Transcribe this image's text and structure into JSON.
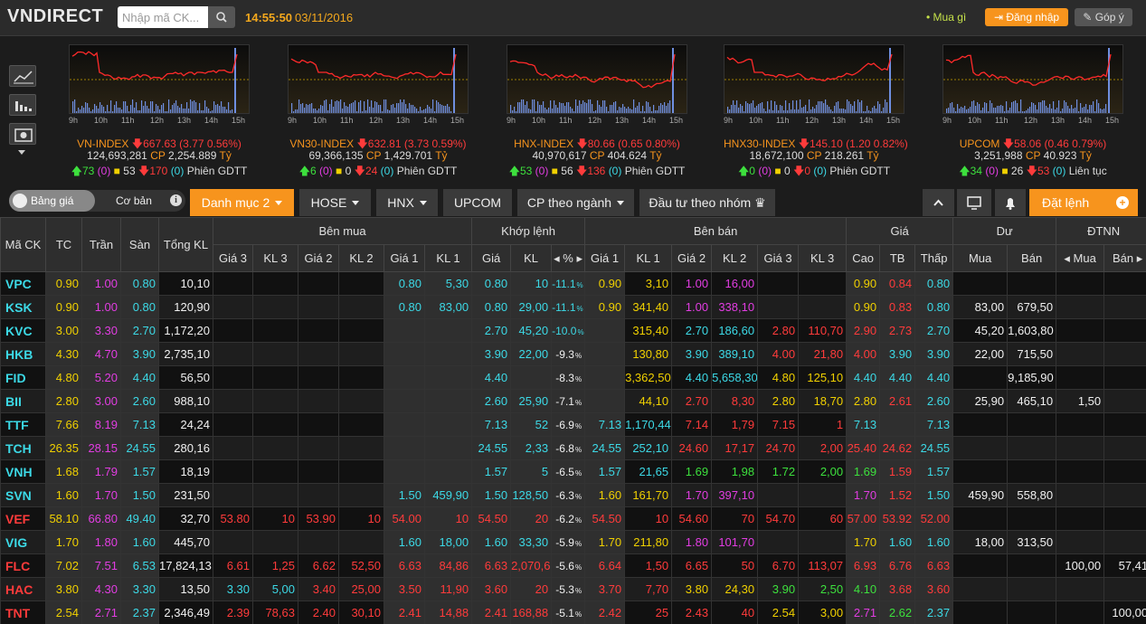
{
  "header": {
    "logo": "VNDIRECT",
    "search_placeholder": "Nhập mã CK...",
    "time": "14:55:50",
    "date": "03/11/2016",
    "mua_gi": "Mua gì",
    "login_label": "Đăng nhập",
    "feedback_label": "Góp ý"
  },
  "colors": {
    "accent": "#f7941d",
    "up": "#3de03d",
    "down": "#ff3b3b",
    "ref": "#f0d000",
    "ceiling": "#e23de2",
    "floor": "#3cd9e6"
  },
  "index_ticks": [
    "9h",
    "10h",
    "11h",
    "12h",
    "13h",
    "14h",
    "15h"
  ],
  "indices": [
    {
      "name": "VN-INDEX",
      "value": "667.63",
      "change": "(3.77 0.56%)",
      "volume": "124,693,281",
      "cp_label": "CP",
      "cp_value": "2,254.889",
      "unit": "Tỷ",
      "up": "73",
      "up_ceiling": "(0)",
      "ref": "53",
      "down": "170",
      "down_floor": "(0)",
      "session": "Phiên GDTT"
    },
    {
      "name": "VN30-INDEX",
      "value": "632.81",
      "change": "(3.73 0.59%)",
      "volume": "69,366,135",
      "cp_label": "CP",
      "cp_value": "1,429.701",
      "unit": "Tỷ",
      "up": "6",
      "up_ceiling": "(0)",
      "ref": "0",
      "down": "24",
      "down_floor": "(0)",
      "session": "Phiên GDTT"
    },
    {
      "name": "HNX-INDEX",
      "value": "80.66",
      "change": "(0.65 0.80%)",
      "volume": "40,970,617",
      "cp_label": "CP",
      "cp_value": "404.624",
      "unit": "Tỷ",
      "up": "53",
      "up_ceiling": "(0)",
      "ref": "56",
      "down": "136",
      "down_floor": "(0)",
      "session": "Phiên GDTT"
    },
    {
      "name": "HNX30-INDEX",
      "value": "145.10",
      "change": "(1.20 0.82%)",
      "volume": "18,672,100",
      "cp_label": "CP",
      "cp_value": "218.261",
      "unit": "Tỷ",
      "up": "0",
      "up_ceiling": "(0)",
      "ref": "0",
      "down": "0",
      "down_floor": "(0)",
      "session": "Phiên GDTT"
    },
    {
      "name": "UPCOM",
      "value": "58.06",
      "change": "(0.46 0.79%)",
      "volume": "3,251,988",
      "cp_label": "CP",
      "cp_value": "40.923",
      "unit": "Tỷ",
      "up": "34",
      "up_ceiling": "(0)",
      "ref": "26",
      "down": "53",
      "down_floor": "(0)",
      "session": "Liên tục"
    }
  ],
  "tabs": {
    "toggle_on": "Bảng giá",
    "toggle_off": "Cơ bản",
    "items": [
      "Danh mục 2",
      "HOSE",
      "HNX",
      "UPCOM",
      "CP theo ngành",
      "Đầu tư theo nhóm"
    ],
    "order_button": "Đặt lệnh"
  },
  "table": {
    "group_headers": {
      "symbol": "Mã CK",
      "tc": "TC",
      "tran": "Trần",
      "san": "Sàn",
      "total": "Tổng KL",
      "buy": "Bên mua",
      "match": "Khớp lệnh",
      "sell": "Bên bán",
      "price": "Giá",
      "remain": "Dư",
      "foreign": "ĐTNN"
    },
    "sub_headers": [
      "Giá 3",
      "KL 3",
      "Giá 2",
      "KL 2",
      "Giá 1",
      "KL 1",
      "Giá",
      "KL",
      "%",
      "Giá 1",
      "KL 1",
      "Giá 2",
      "KL 2",
      "Giá 3",
      "KL 3",
      "Cao",
      "TB",
      "Thấp",
      "Mua",
      "Bán",
      "Mua",
      "Bán"
    ],
    "rows": [
      {
        "c": [
          "VPC",
          "0.90",
          "1.00",
          "0.80",
          "10,10",
          "",
          "",
          "",
          "",
          "0.80",
          "5,30",
          "0.80",
          "10",
          "-11.1",
          "0.90",
          "3,10",
          "1.00",
          "16,00",
          "",
          "",
          "0.90",
          "0.84",
          "0.80",
          "",
          "",
          "",
          ""
        ],
        "k": [
          "cyan",
          "yellow",
          "purple",
          "cyan",
          "white",
          "",
          "",
          "",
          "",
          "cyan",
          "cyan",
          "cyan",
          "cyan",
          "cyan",
          "yellow",
          "yellow",
          "purple",
          "purple",
          "",
          "",
          "yellow",
          "red",
          "cyan",
          "",
          "",
          "",
          ""
        ]
      },
      {
        "c": [
          "KSK",
          "0.90",
          "1.00",
          "0.80",
          "120,90",
          "",
          "",
          "",
          "",
          "0.80",
          "83,00",
          "0.80",
          "29,00",
          "-11.1",
          "0.90",
          "341,40",
          "1.00",
          "338,10",
          "",
          "",
          "0.90",
          "0.83",
          "0.80",
          "83,00",
          "679,50",
          "",
          ""
        ],
        "k": [
          "cyan",
          "yellow",
          "purple",
          "cyan",
          "white",
          "",
          "",
          "",
          "",
          "cyan",
          "cyan",
          "cyan",
          "cyan",
          "cyan",
          "yellow",
          "yellow",
          "purple",
          "purple",
          "",
          "",
          "yellow",
          "red",
          "cyan",
          "white",
          "white",
          "",
          ""
        ]
      },
      {
        "c": [
          "KVC",
          "3.00",
          "3.30",
          "2.70",
          "1,172,20",
          "",
          "",
          "",
          "",
          "",
          "",
          "2.70",
          "45,20",
          "-10.0",
          "",
          "315,40",
          "2.70",
          "186,60",
          "2.80",
          "110,70",
          "2.90",
          "2.73",
          "2.70",
          "45,20",
          "1,603,80",
          "",
          ""
        ],
        "k": [
          "cyan",
          "yellow",
          "purple",
          "cyan",
          "white",
          "",
          "",
          "",
          "",
          "",
          "",
          "cyan",
          "cyan",
          "cyan",
          "",
          "yellow",
          "cyan",
          "cyan",
          "red",
          "red",
          "red",
          "red",
          "cyan",
          "white",
          "white",
          "",
          ""
        ]
      },
      {
        "c": [
          "HKB",
          "4.30",
          "4.70",
          "3.90",
          "2,735,10",
          "",
          "",
          "",
          "",
          "",
          "",
          "3.90",
          "22,00",
          "-9.3",
          "",
          "130,80",
          "3.90",
          "389,10",
          "4.00",
          "21,80",
          "4.00",
          "3.90",
          "3.90",
          "22,00",
          "715,50",
          "",
          ""
        ],
        "k": [
          "cyan",
          "yellow",
          "purple",
          "cyan",
          "white",
          "",
          "",
          "",
          "",
          "",
          "",
          "cyan",
          "cyan",
          "white",
          "",
          "yellow",
          "cyan",
          "cyan",
          "red",
          "red",
          "red",
          "cyan",
          "cyan",
          "white",
          "white",
          "",
          ""
        ]
      },
      {
        "c": [
          "FID",
          "4.80",
          "5.20",
          "4.40",
          "56,50",
          "",
          "",
          "",
          "",
          "",
          "",
          "4.40",
          "",
          "-8.3",
          "",
          "3,362,50",
          "4.40",
          "5,658,30",
          "4.80",
          "125,10",
          "4.40",
          "4.40",
          "4.40",
          "",
          "9,185,90",
          "",
          ""
        ],
        "k": [
          "cyan",
          "yellow",
          "purple",
          "cyan",
          "white",
          "",
          "",
          "",
          "",
          "",
          "",
          "cyan",
          "cyan",
          "white",
          "",
          "yellow",
          "cyan",
          "cyan",
          "yellow",
          "yellow",
          "cyan",
          "cyan",
          "cyan",
          "",
          "white",
          "",
          ""
        ]
      },
      {
        "c": [
          "BII",
          "2.80",
          "3.00",
          "2.60",
          "988,10",
          "",
          "",
          "",
          "",
          "",
          "",
          "2.60",
          "25,90",
          "-7.1",
          "",
          "44,10",
          "2.70",
          "8,30",
          "2.80",
          "18,70",
          "2.80",
          "2.61",
          "2.60",
          "25,90",
          "465,10",
          "1,50",
          ""
        ],
        "k": [
          "cyan",
          "yellow",
          "purple",
          "cyan",
          "white",
          "",
          "",
          "",
          "",
          "",
          "",
          "cyan",
          "cyan",
          "white",
          "",
          "yellow",
          "red",
          "red",
          "yellow",
          "yellow",
          "yellow",
          "red",
          "cyan",
          "white",
          "white",
          "white",
          ""
        ]
      },
      {
        "c": [
          "TTF",
          "7.66",
          "8.19",
          "7.13",
          "24,24",
          "",
          "",
          "",
          "",
          "",
          "",
          "7.13",
          "52",
          "-6.9",
          "7.13",
          "1,170,44",
          "7.14",
          "1,79",
          "7.15",
          "1",
          "7.13",
          "",
          "7.13",
          "",
          "",
          "",
          ""
        ],
        "k": [
          "cyan",
          "yellow",
          "purple",
          "cyan",
          "white",
          "",
          "",
          "",
          "",
          "",
          "",
          "cyan",
          "cyan",
          "white",
          "cyan",
          "cyan",
          "red",
          "red",
          "red",
          "red",
          "cyan",
          "",
          "cyan",
          "",
          "",
          "",
          ""
        ]
      },
      {
        "c": [
          "TCH",
          "26.35",
          "28.15",
          "24.55",
          "280,16",
          "",
          "",
          "",
          "",
          "",
          "",
          "24.55",
          "2,33",
          "-6.8",
          "24.55",
          "252,10",
          "24.60",
          "17,17",
          "24.70",
          "2,00",
          "25.40",
          "24.62",
          "24.55",
          "",
          "",
          "",
          ""
        ],
        "k": [
          "cyan",
          "yellow",
          "purple",
          "cyan",
          "white",
          "",
          "",
          "",
          "",
          "",
          "",
          "cyan",
          "cyan",
          "white",
          "cyan",
          "cyan",
          "red",
          "red",
          "red",
          "red",
          "red",
          "red",
          "cyan",
          "",
          "",
          "",
          ""
        ]
      },
      {
        "c": [
          "VNH",
          "1.68",
          "1.79",
          "1.57",
          "18,19",
          "",
          "",
          "",
          "",
          "",
          "",
          "1.57",
          "5",
          "-6.5",
          "1.57",
          "21,65",
          "1.69",
          "1,98",
          "1.72",
          "2,00",
          "1.69",
          "1.59",
          "1.57",
          "",
          "",
          "",
          ""
        ],
        "k": [
          "cyan",
          "yellow",
          "purple",
          "cyan",
          "white",
          "",
          "",
          "",
          "",
          "",
          "",
          "cyan",
          "cyan",
          "white",
          "cyan",
          "cyan",
          "green",
          "green",
          "green",
          "green",
          "green",
          "red",
          "cyan",
          "",
          "",
          "",
          ""
        ]
      },
      {
        "c": [
          "SVN",
          "1.60",
          "1.70",
          "1.50",
          "231,50",
          "",
          "",
          "",
          "",
          "1.50",
          "459,90",
          "1.50",
          "128,50",
          "-6.3",
          "1.60",
          "161,70",
          "1.70",
          "397,10",
          "",
          "",
          "1.70",
          "1.52",
          "1.50",
          "459,90",
          "558,80",
          "",
          ""
        ],
        "k": [
          "cyan",
          "yellow",
          "purple",
          "cyan",
          "white",
          "",
          "",
          "",
          "",
          "cyan",
          "cyan",
          "cyan",
          "cyan",
          "white",
          "yellow",
          "yellow",
          "purple",
          "purple",
          "",
          "",
          "purple",
          "red",
          "cyan",
          "white",
          "white",
          "",
          ""
        ]
      },
      {
        "c": [
          "VEF",
          "58.10",
          "66.80",
          "49.40",
          "32,70",
          "53.80",
          "10",
          "53.90",
          "10",
          "54.00",
          "10",
          "54.50",
          "20",
          "-6.2",
          "54.50",
          "10",
          "54.60",
          "70",
          "54.70",
          "60",
          "57.00",
          "53.92",
          "52.00",
          "",
          "",
          "",
          ""
        ],
        "k": [
          "red",
          "yellow",
          "purple",
          "cyan",
          "white",
          "red",
          "red",
          "red",
          "red",
          "red",
          "red",
          "red",
          "red",
          "white",
          "red",
          "red",
          "red",
          "red",
          "red",
          "red",
          "red",
          "red",
          "red",
          "",
          "",
          "",
          ""
        ]
      },
      {
        "c": [
          "VIG",
          "1.70",
          "1.80",
          "1.60",
          "445,70",
          "",
          "",
          "",
          "",
          "1.60",
          "18,00",
          "1.60",
          "33,30",
          "-5.9",
          "1.70",
          "211,80",
          "1.80",
          "101,70",
          "",
          "",
          "1.70",
          "1.60",
          "1.60",
          "18,00",
          "313,50",
          "",
          ""
        ],
        "k": [
          "cyan",
          "yellow",
          "purple",
          "cyan",
          "white",
          "",
          "",
          "",
          "",
          "cyan",
          "cyan",
          "cyan",
          "cyan",
          "white",
          "yellow",
          "yellow",
          "purple",
          "purple",
          "",
          "",
          "yellow",
          "cyan",
          "cyan",
          "white",
          "white",
          "",
          ""
        ]
      },
      {
        "c": [
          "FLC",
          "7.02",
          "7.51",
          "6.53",
          "17,824,13",
          "6.61",
          "1,25",
          "6.62",
          "52,50",
          "6.63",
          "84,86",
          "6.63",
          "2,070,6",
          "-5.6",
          "6.64",
          "1,50",
          "6.65",
          "50",
          "6.70",
          "113,07",
          "6.93",
          "6.76",
          "6.63",
          "",
          "",
          "100,00",
          "57,41"
        ],
        "k": [
          "red",
          "yellow",
          "purple",
          "cyan",
          "white",
          "red",
          "red",
          "red",
          "red",
          "red",
          "red",
          "red",
          "red",
          "white",
          "red",
          "red",
          "red",
          "red",
          "red",
          "red",
          "red",
          "red",
          "red",
          "",
          "",
          "white",
          "white"
        ]
      },
      {
        "c": [
          "HAC",
          "3.80",
          "4.30",
          "3.30",
          "13,50",
          "3.30",
          "5,00",
          "3.40",
          "25,00",
          "3.50",
          "11,90",
          "3.60",
          "20",
          "-5.3",
          "3.70",
          "7,70",
          "3.80",
          "24,30",
          "3.90",
          "2,50",
          "4.10",
          "3.68",
          "3.60",
          "",
          "",
          "",
          ""
        ],
        "k": [
          "red",
          "yellow",
          "purple",
          "cyan",
          "white",
          "cyan",
          "cyan",
          "red",
          "red",
          "red",
          "red",
          "red",
          "red",
          "white",
          "red",
          "red",
          "yellow",
          "yellow",
          "green",
          "green",
          "green",
          "red",
          "red",
          "",
          "",
          "",
          ""
        ]
      },
      {
        "c": [
          "TNT",
          "2.54",
          "2.71",
          "2.37",
          "2,346,49",
          "2.39",
          "78,63",
          "2.40",
          "30,10",
          "2.41",
          "14,88",
          "2.41",
          "168,88",
          "-5.1",
          "2.42",
          "25",
          "2.43",
          "40",
          "2.54",
          "3,00",
          "2.71",
          "2.62",
          "2.37",
          "",
          "",
          "",
          "100,00"
        ],
        "k": [
          "red",
          "yellow",
          "purple",
          "cyan",
          "white",
          "red",
          "red",
          "red",
          "red",
          "red",
          "red",
          "red",
          "red",
          "white",
          "red",
          "red",
          "red",
          "red",
          "yellow",
          "yellow",
          "purple",
          "green",
          "cyan",
          "",
          "",
          "",
          "white"
        ]
      }
    ]
  }
}
